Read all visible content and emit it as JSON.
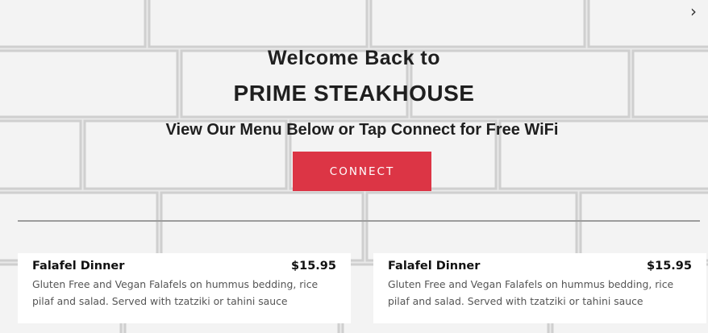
{
  "header": {
    "welcome_text": "Welcome Back to",
    "restaurant_name": "PRIME STEAKHOUSE",
    "tagline": "View Our Menu Below or Tap Connect for Free WiFi"
  },
  "connect_button": {
    "label": "CONNECT",
    "color": "#dc3545"
  },
  "navigation": {
    "next_icon": "chevron-right-icon",
    "next_glyph": "›"
  },
  "menu": {
    "items": [
      {
        "name": "Falafel Dinner",
        "price": "$15.95",
        "description": "Gluten Free and Vegan Falafels on hummus bedding, rice pilaf and salad. Served with tzatziki or tahini sauce"
      },
      {
        "name": "Falafel Dinner",
        "price": "$15.95",
        "description": "Gluten Free and Vegan Falafels on hummus bedding, rice pilaf and salad. Served with tzatziki or tahini sauce"
      }
    ]
  }
}
